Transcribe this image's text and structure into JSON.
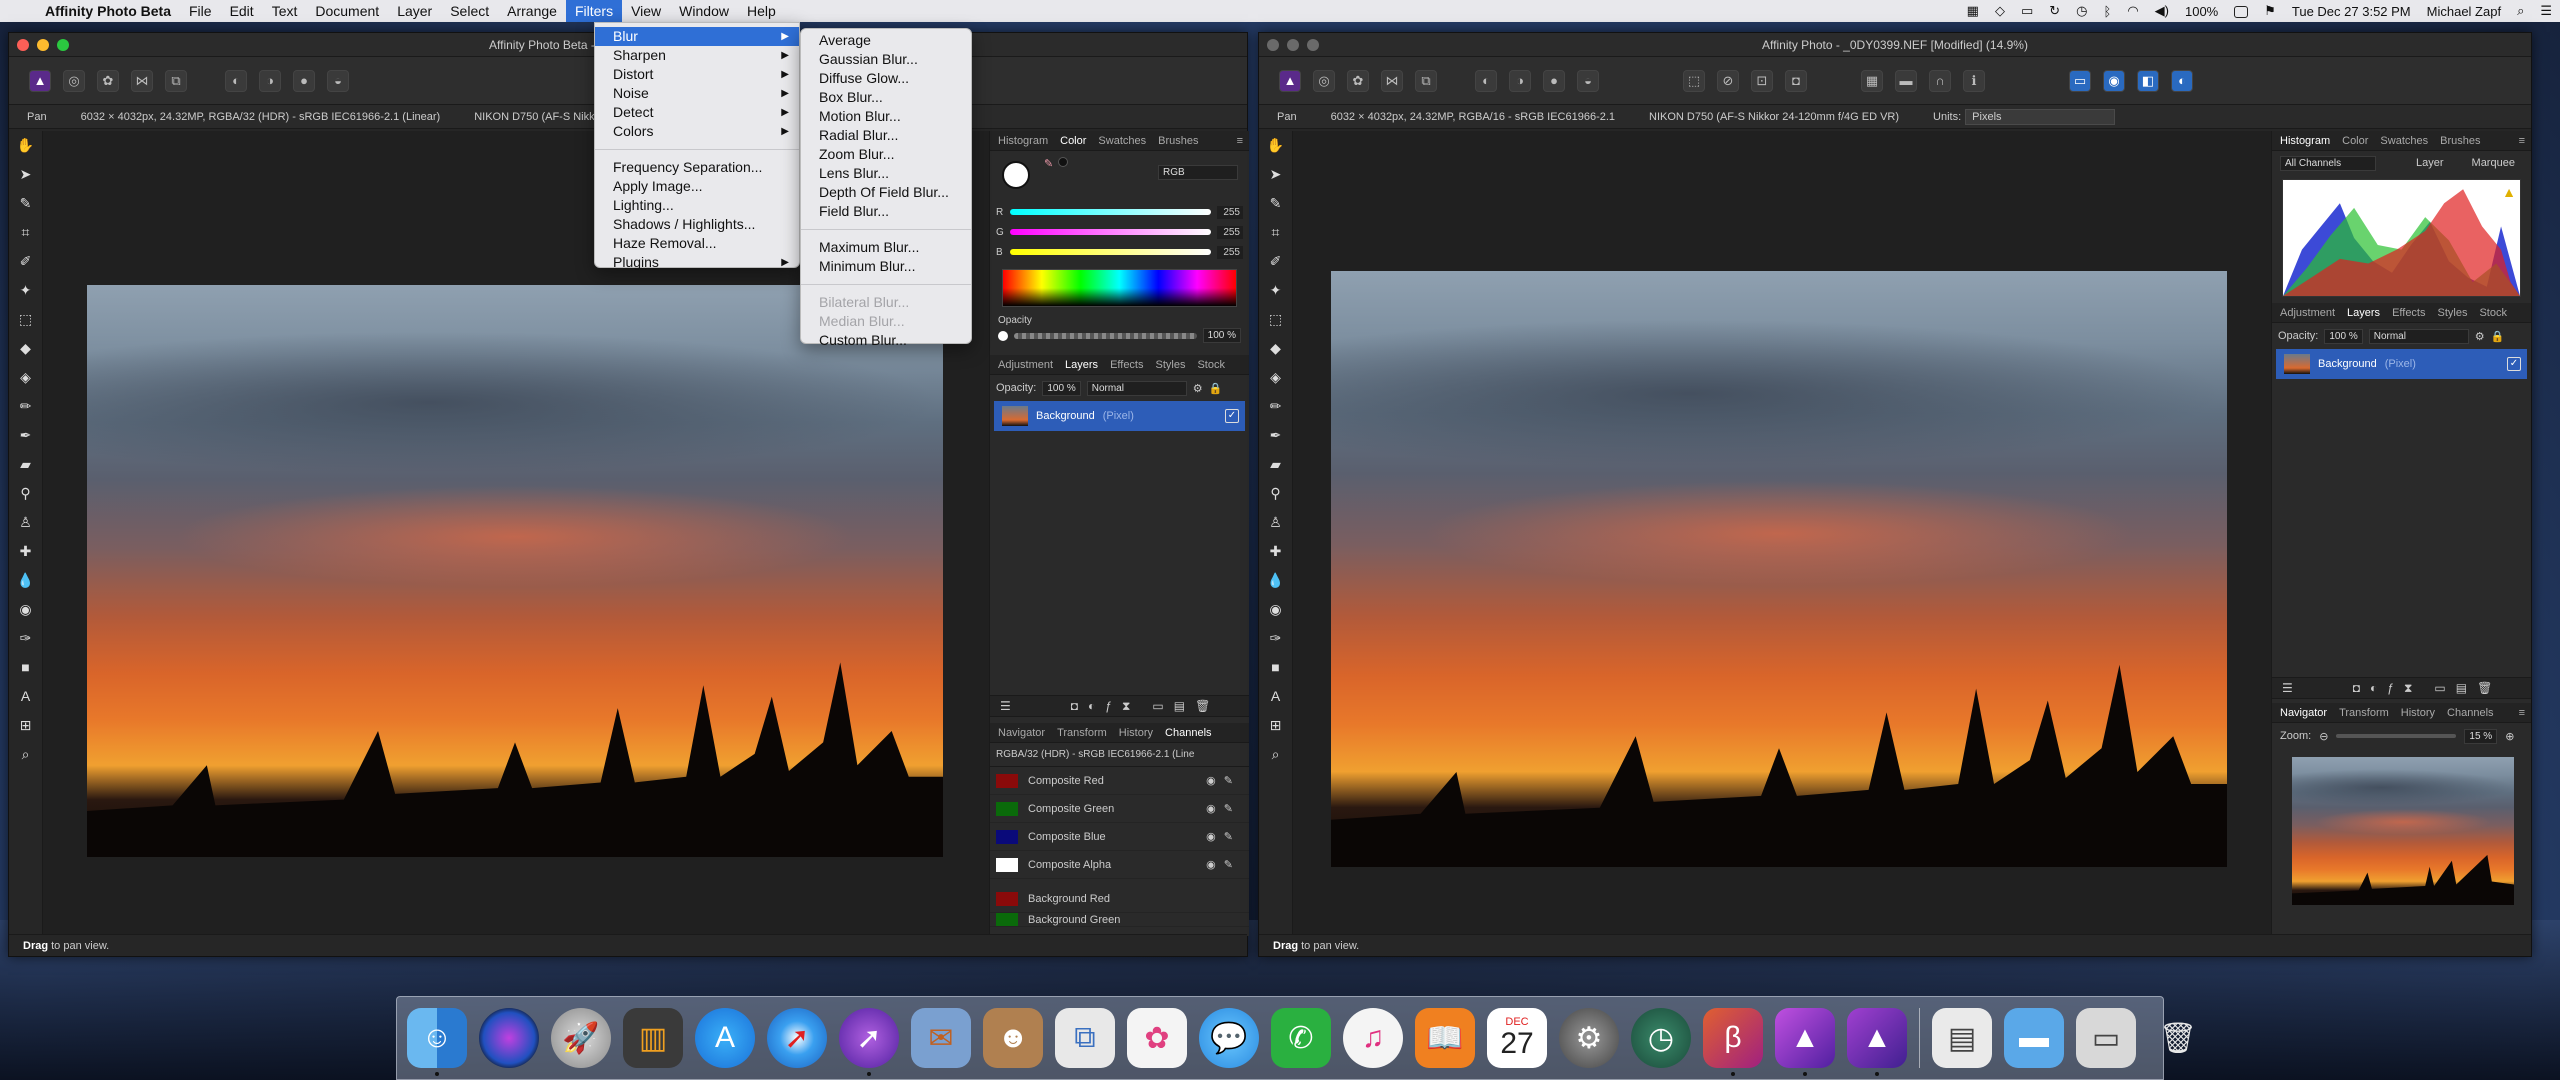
{
  "menubar": {
    "app": "Affinity Photo Beta",
    "items": [
      "File",
      "Edit",
      "Text",
      "Document",
      "Layer",
      "Select",
      "Arrange",
      "Filters",
      "View",
      "Window",
      "Help"
    ],
    "active": "Filters",
    "battery": "100%",
    "datetime": "Tue Dec 27  3:52 PM",
    "user": "Michael Zapf"
  },
  "filters_menu": {
    "items": [
      {
        "label": "Blur",
        "submenu": true,
        "selected": true
      },
      {
        "label": "Sharpen",
        "submenu": true
      },
      {
        "label": "Distort",
        "submenu": true
      },
      {
        "label": "Noise",
        "submenu": true
      },
      {
        "label": "Detect",
        "submenu": true
      },
      {
        "label": "Colors",
        "submenu": true
      },
      {
        "sep": true
      },
      {
        "label": "Frequency Separation..."
      },
      {
        "label": "Apply Image..."
      },
      {
        "label": "Lighting..."
      },
      {
        "label": "Shadows / Highlights..."
      },
      {
        "label": "Haze Removal..."
      },
      {
        "label": "Plugins",
        "submenu": true
      }
    ]
  },
  "blur_menu": {
    "items": [
      {
        "label": "Average"
      },
      {
        "label": "Gaussian Blur..."
      },
      {
        "label": "Diffuse Glow..."
      },
      {
        "label": "Box Blur..."
      },
      {
        "label": "Motion Blur..."
      },
      {
        "label": "Radial Blur..."
      },
      {
        "label": "Zoom Blur..."
      },
      {
        "label": "Lens Blur..."
      },
      {
        "label": "Depth Of Field Blur..."
      },
      {
        "label": "Field Blur..."
      },
      {
        "sep": true
      },
      {
        "label": "Maximum Blur..."
      },
      {
        "label": "Minimum Blur..."
      },
      {
        "sep": true
      },
      {
        "label": "Bilateral Blur...",
        "disabled": true
      },
      {
        "label": "Median Blur...",
        "disabled": true
      },
      {
        "label": "Custom Blur..."
      }
    ]
  },
  "window1": {
    "title": "Affinity Photo Beta -",
    "tool": "Pan",
    "info": "6032 × 4032px, 24.32MP, RGBA/32 (HDR) - sRGB IEC61966-2.1 (Linear)",
    "camera": "NIKON D750 (AF-S Nikkor 24",
    "status_bold": "Drag",
    "status_rest": " to pan view.",
    "top_tabs": [
      "Histogram",
      "Color",
      "Swatches",
      "Brushes"
    ],
    "top_tab_active": "Color",
    "color_model": "RGB",
    "sliders": [
      {
        "label": "R",
        "value": "255",
        "color": "linear-gradient(90deg,#0ff,#fff)"
      },
      {
        "label": "G",
        "value": "255",
        "color": "linear-gradient(90deg,#f0f,#fff)"
      },
      {
        "label": "B",
        "value": "255",
        "color": "linear-gradient(90deg,#ff0,#fff)"
      }
    ],
    "opacity_label": "Opacity",
    "opacity_value": "100 %",
    "layer_tabs": [
      "Adjustment",
      "Layers",
      "Effects",
      "Styles",
      "Stock"
    ],
    "layer_tab_active": "Layers",
    "layer_opacity_label": "Opacity:",
    "layer_opacity": "100 %",
    "blend_mode": "Normal",
    "layer_name": "Background",
    "layer_type": "(Pixel)",
    "bottom_tabs": [
      "Navigator",
      "Transform",
      "History",
      "Channels"
    ],
    "bottom_tab_active": "Channels",
    "channel_info": "RGBA/32 (HDR) - sRGB IEC61966-2.1 (Line",
    "channels": [
      {
        "name": "Composite Red",
        "color": "#8a0a0a"
      },
      {
        "name": "Composite Green",
        "color": "#0a6a0a"
      },
      {
        "name": "Composite Blue",
        "color": "#0a0a7a"
      },
      {
        "name": "Composite Alpha",
        "color": "#ffffff"
      },
      {
        "name": "Background Red",
        "color": "#8a0a0a"
      },
      {
        "name": "Background Green",
        "color": "#0a6a0a"
      }
    ]
  },
  "window2": {
    "title": "Affinity Photo - _0DY0399.NEF [Modified] (14.9%)",
    "tool": "Pan",
    "info": "6032 × 4032px, 24.32MP, RGBA/16 - sRGB IEC61966-2.1",
    "camera": "NIKON D750 (AF-S Nikkor 24-120mm f/4G ED VR)",
    "units_label": "Units:",
    "units_value": "Pixels",
    "status_bold": "Drag",
    "status_rest": " to pan view.",
    "top_tabs": [
      "Histogram",
      "Color",
      "Swatches",
      "Brushes"
    ],
    "top_tab_active": "Histogram",
    "channels_select": "All Channels",
    "hist_opts": [
      "Layer",
      "Marquee"
    ],
    "layer_tabs": [
      "Adjustment",
      "Layers",
      "Effects",
      "Styles",
      "Stock"
    ],
    "layer_tab_active": "Layers",
    "layer_opacity_label": "Opacity:",
    "layer_opacity": "100 %",
    "blend_mode": "Normal",
    "layer_name": "Background",
    "layer_type": "(Pixel)",
    "bottom_tabs": [
      "Navigator",
      "Transform",
      "History",
      "Channels"
    ],
    "bottom_tab_active": "Navigator",
    "zoom_label": "Zoom:",
    "zoom_value": "15 %"
  },
  "dock": {
    "icons": [
      "finder-icon",
      "siri-icon",
      "launchpad-icon",
      "photo-booth-icon",
      "app-store-icon",
      "safari-icon",
      "safari-preview-icon",
      "mail-bird-icon",
      "contacts-icon",
      "preview-icon",
      "photos-icon",
      "messages-icon",
      "facetime-icon",
      "itunes-icon",
      "ibooks-icon",
      "calendar-icon",
      "system-preferences-icon",
      "time-machine-icon",
      "affinity-photo-beta-icon",
      "affinity-photo-icon",
      "affinity-photo-2-icon",
      "documents-icon",
      "folder-icon",
      "screenshot-icon",
      "trash-icon"
    ],
    "calendar_month": "DEC",
    "calendar_day": "27"
  }
}
